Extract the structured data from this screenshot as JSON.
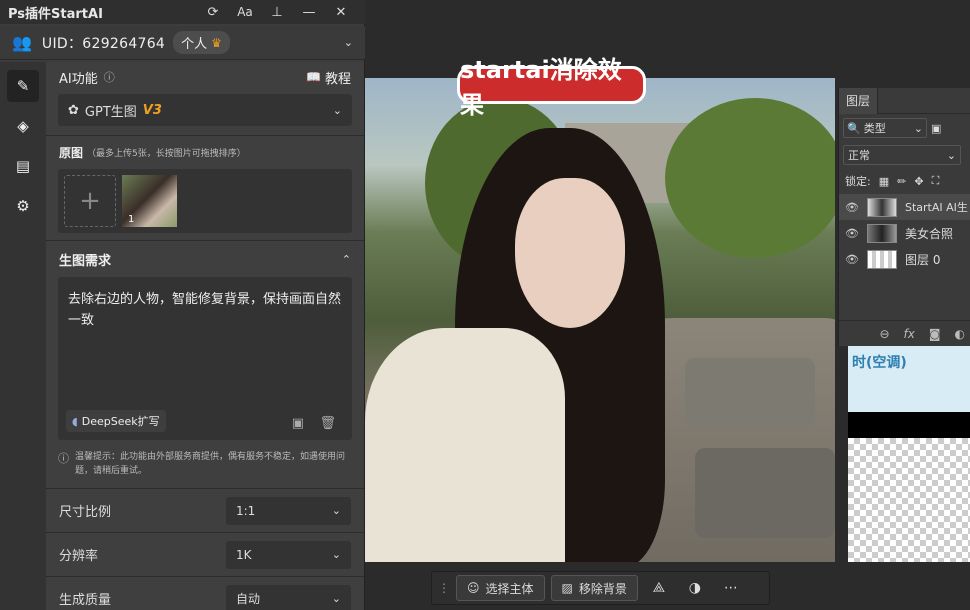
{
  "plugin": {
    "title": "Ps插件StartAI",
    "uid": "UID：629264764",
    "account_type": "个人",
    "ai_function_label": "AI功能",
    "tutorial_label": "教程",
    "model_name": "GPT生图",
    "model_version": "V3",
    "original_label": "原图",
    "original_hint": "（最多上传5张，长按图片可拖拽排序）",
    "thumb_index": "1",
    "prompt_section_label": "生图需求",
    "prompt_text": "去除右边的人物，智能修复背景，保持画面自然一致",
    "deepseek_label": "DeepSeek扩写",
    "notice": "温馨提示：此功能由外部服务商提供，偶有服务不稳定，如遇使用问题，请稍后重试。",
    "aspect_label": "尺寸比例",
    "aspect_value": "1:1",
    "resolution_label": "分辨率",
    "resolution_value": "1K",
    "quality_label": "生成质量",
    "quality_value": "自动"
  },
  "overlay_tag": "startai消除效果",
  "layers": {
    "tab_label": "图层",
    "filter_label": "类型",
    "blend_mode": "正常",
    "lock_label": "锁定:",
    "items": [
      {
        "name": "StartAI AI生"
      },
      {
        "name": "美女合照"
      },
      {
        "name": "图层 0"
      }
    ],
    "preview_text": "时(空调)"
  },
  "taskbar": {
    "select_subject": "选择主体",
    "remove_bg": "移除背景"
  },
  "colors": {
    "accent_orange": "#f0a020",
    "tag_red": "#cc2c2c"
  }
}
